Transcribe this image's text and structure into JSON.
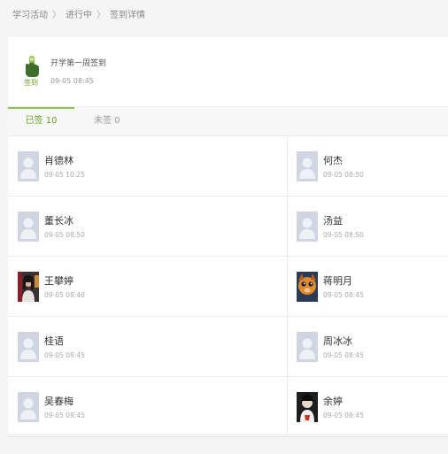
{
  "breadcrumb": {
    "items": [
      "学习活动",
      "进行中",
      "签到详情"
    ],
    "separator": "〉"
  },
  "activity": {
    "icon": "hand-pointer-icon",
    "icon_label": "签到",
    "title": "开学第一周签到",
    "time": "09-05 08:45"
  },
  "tabs": {
    "signed": "已签 10",
    "unsigned": "未签 0"
  },
  "colors": {
    "accent": "#8cc34a",
    "accent_text": "#6a9e25"
  },
  "members": [
    {
      "name": "肖德林",
      "time": "09-05 10:25",
      "avatar": "default-avatar-icon"
    },
    {
      "name": "何杰",
      "time": "09-05 08:50",
      "avatar": "default-avatar-icon"
    },
    {
      "name": "董长冰",
      "time": "09-05 08:50",
      "avatar": "default-avatar-icon"
    },
    {
      "name": "汤益",
      "time": "09-05 08:50",
      "avatar": "default-avatar-icon"
    },
    {
      "name": "王攀婷",
      "time": "09-05 08:46",
      "avatar": "photo-avatar"
    },
    {
      "name": "蒋明月",
      "time": "09-05 08:45",
      "avatar": "photo-avatar"
    },
    {
      "name": "桂语",
      "time": "09-05 08:45",
      "avatar": "default-avatar-icon"
    },
    {
      "name": "周冰冰",
      "time": "09-05 08:45",
      "avatar": "default-avatar-icon"
    },
    {
      "name": "吴春梅",
      "time": "09-05 08:45",
      "avatar": "default-avatar-icon"
    },
    {
      "name": "余婷",
      "time": "09-05 08:45",
      "avatar": "photo-avatar"
    }
  ]
}
